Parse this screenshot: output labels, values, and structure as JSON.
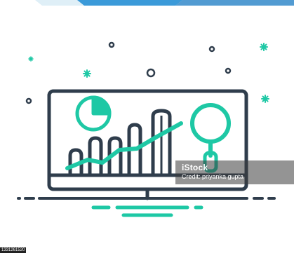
{
  "illustration": {
    "subject": "monitor-analytics-icon",
    "colors": {
      "outline": "#2f3d4c",
      "accent": "#1ec8a5",
      "banner_light": "#dfeff7",
      "banner_blue": "#3b9ad9"
    }
  },
  "watermark": {
    "brand": "iStock",
    "credit": "Credit: priyanka gupta"
  },
  "image_id": "1331261520"
}
